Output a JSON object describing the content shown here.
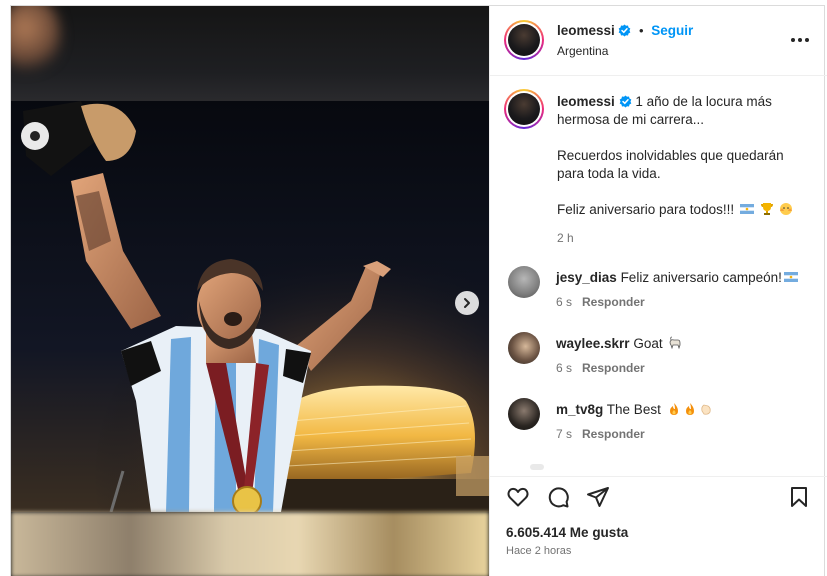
{
  "post": {
    "author": "leomessi",
    "follow_label": "Seguir",
    "location": "Argentina",
    "more_icon": "more-horizontal-icon",
    "caption": {
      "line1": "1 año de la locura más",
      "line2": "hermosa de mi carrera...",
      "line3": "Recuerdos inolvidables que quedarán",
      "line4": "para toda la vida.",
      "line5": "Feliz aniversario para todos!!!",
      "time": "2 h"
    }
  },
  "comments": [
    {
      "user": "jesy_dias",
      "text": "Feliz aniversario campeón!",
      "time": "6 s",
      "reply": "Responder"
    },
    {
      "user": "waylee.skrr",
      "text": "Goat",
      "time": "6 s",
      "reply": "Responder"
    },
    {
      "user": "m_tv8g",
      "text": "The Best",
      "time": "7 s",
      "reply": "Responder"
    }
  ],
  "footer": {
    "likes": "6.605.414 Me gusta",
    "posted": "Hace 2 horas"
  },
  "colors": {
    "accent": "#0095f6",
    "verified": "#0095f6",
    "text": "#262626",
    "muted": "#737373",
    "border": "#dbdbdb"
  }
}
